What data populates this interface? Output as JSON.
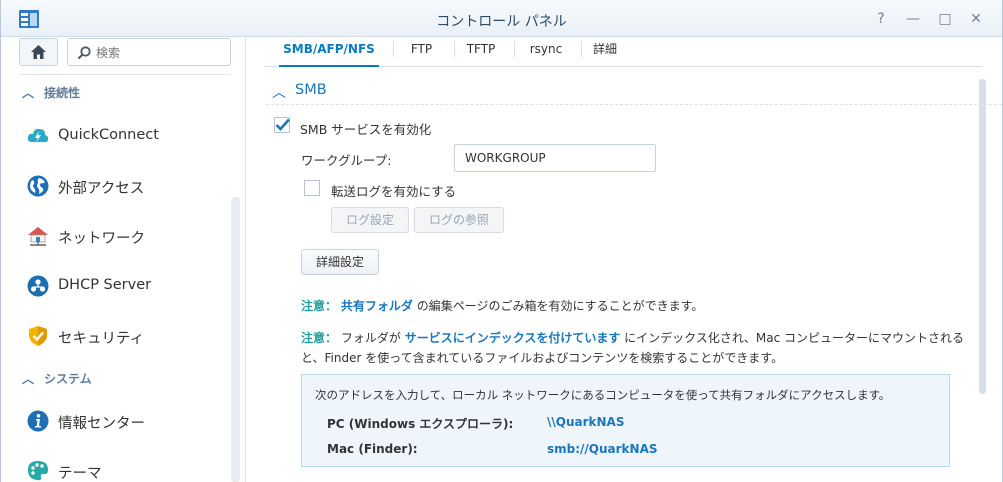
{
  "window": {
    "title": "コントロール パネル"
  },
  "controls": {
    "help": "?",
    "minimize": "—",
    "maximize": "□",
    "close": "✕"
  },
  "sidebar": {
    "search_placeholder": "検索",
    "sections": [
      {
        "label": "接続性"
      },
      {
        "label": "システム"
      }
    ],
    "items": [
      {
        "label": "QuickConnect",
        "icon": "quickconnect-icon",
        "color": "#2aa9c9"
      },
      {
        "label": "外部アクセス",
        "icon": "globe-icon",
        "color": "#1f6fb4"
      },
      {
        "label": "ネットワーク",
        "icon": "network-house-icon",
        "color": "#d9534f"
      },
      {
        "label": "DHCP Server",
        "icon": "dhcp-icon",
        "color": "#1e6fb0"
      },
      {
        "label": "セキュリティ",
        "icon": "shield-icon",
        "color": "#f0b400"
      },
      {
        "label": "情報センター",
        "icon": "info-icon",
        "color": "#1f6fb4"
      },
      {
        "label": "テーマ",
        "icon": "palette-icon",
        "color": "#27a9a5"
      }
    ]
  },
  "tabs": [
    {
      "label": "SMB/AFP/NFS"
    },
    {
      "label": "FTP"
    },
    {
      "label": "TFTP"
    },
    {
      "label": "rsync"
    },
    {
      "label": "詳細"
    }
  ],
  "smb": {
    "title": "SMB",
    "enable_label": "SMB サービスを有効化",
    "enable_checked": true,
    "workgroup_label": "ワークグループ:",
    "workgroup_value": "WORKGROUP",
    "log_label": "転送ログを有効にする",
    "log_checked": false,
    "log_settings_btn": "ログ設定",
    "log_view_btn": "ログの参照",
    "advanced_btn": "詳細設定",
    "note_tag": "注意：",
    "note1_link": "共有フォルダ",
    "note1_text": "の編集ページのごみ箱を有効にすることができます。",
    "note2_pre": "フォルダが",
    "note2_link": "サービスにインデックスを付けています",
    "note2_text": "にインデックス化され、Mac コンピューターにマウントされる",
    "note2_line2": "と、Finder を使って含まれているファイルおよびコンテンツを検索することができます。",
    "info_head": "次のアドレスを入力して、ローカル ネットワークにあるコンピュータを使って共有フォルダにアクセスします。",
    "pc_label": "PC (Windows エクスプローラ):",
    "pc_value": "\\\\QuarkNAS",
    "mac_label": "Mac (Finder):",
    "mac_value": "smb://QuarkNAS"
  }
}
